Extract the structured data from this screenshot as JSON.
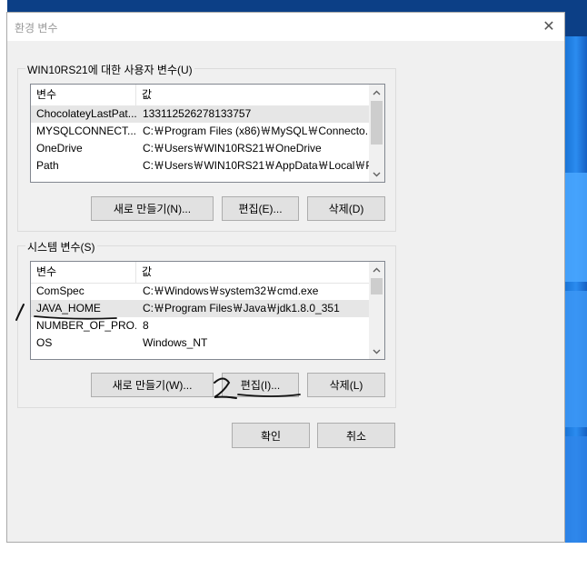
{
  "window": {
    "title": "환경 변수",
    "close_glyph": "✕"
  },
  "user_vars": {
    "group_label": "WIN10RS21에 대한 사용자 변수(U)",
    "columns": [
      "변수",
      "값"
    ],
    "rows": [
      {
        "name": "ChocolateyLastPat...",
        "value": "133112526278133757"
      },
      {
        "name": "MYSQLCONNECT...",
        "value": "C:￦Program Files (x86)￦MySQL￦Connecto..."
      },
      {
        "name": "OneDrive",
        "value": "C:￦Users￦WIN10RS21￦OneDrive"
      },
      {
        "name": "Path",
        "value": "C:￦Users￦WIN10RS21￦AppData￦Local￦P..."
      }
    ],
    "selected_row": 0,
    "buttons": {
      "new": "새로 만들기(N)...",
      "edit": "편집(E)...",
      "delete": "삭제(D)"
    }
  },
  "system_vars": {
    "group_label": "시스템 변수(S)",
    "columns": [
      "변수",
      "값"
    ],
    "rows": [
      {
        "name": "ComSpec",
        "value": "C:￦Windows￦system32￦cmd.exe"
      },
      {
        "name": "JAVA_HOME",
        "value": "C:￦Program Files￦Java￦jdk1.8.0_351"
      },
      {
        "name": "NUMBER_OF_PRO...",
        "value": "8"
      },
      {
        "name": "OS",
        "value": "Windows_NT"
      }
    ],
    "selected_row": 1,
    "buttons": {
      "new": "새로 만들기(W)...",
      "edit": "편집(I)...",
      "delete": "삭제(L)"
    }
  },
  "footer": {
    "ok": "확인",
    "cancel": "취소"
  },
  "annotations": {
    "mark1": "1",
    "mark2": "2"
  },
  "colors": {
    "dialog_bg": "#f0f0f0",
    "button_bg": "#e1e1e1",
    "selected_row": "#e6e6e6",
    "desktop_accent": "#2b8cf0"
  },
  "icons": {
    "close": "close-icon",
    "scroll_up": "scroll-up-icon",
    "scroll_down": "scroll-down-icon"
  }
}
